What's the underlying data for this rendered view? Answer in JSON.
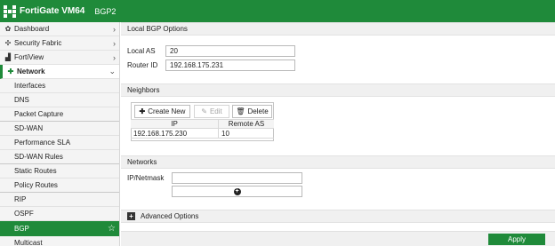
{
  "header": {
    "host": "FortiGate VM64",
    "page": "BGP2",
    "brand_color": "#1f8a3a"
  },
  "sidebar": {
    "items": [
      {
        "label": "Dashboard",
        "icon": "dashboard-icon",
        "chevron": "›"
      },
      {
        "label": "Security Fabric",
        "icon": "fabric-icon",
        "chevron": "›"
      },
      {
        "label": "FortiView",
        "icon": "chart-icon",
        "chevron": "›"
      },
      {
        "label": "Network",
        "icon": "network-icon",
        "chevron": "⌄"
      },
      {
        "label": "Interfaces"
      },
      {
        "label": "DNS"
      },
      {
        "label": "Packet Capture"
      },
      {
        "label": "SD-WAN"
      },
      {
        "label": "Performance SLA"
      },
      {
        "label": "SD-WAN Rules"
      },
      {
        "label": "Static Routes"
      },
      {
        "label": "Policy Routes"
      },
      {
        "label": "RIP"
      },
      {
        "label": "OSPF"
      },
      {
        "label": "BGP",
        "star": "☆"
      },
      {
        "label": "Multicast"
      }
    ]
  },
  "local_bgp": {
    "title": "Local BGP Options",
    "local_as_label": "Local AS",
    "local_as_value": "20",
    "router_id_label": "Router ID",
    "router_id_value": "192.168.175.231"
  },
  "neighbors": {
    "title": "Neighbors",
    "create_label": "Create New",
    "edit_label": "Edit",
    "delete_label": "Delete",
    "columns": [
      "IP",
      "Remote AS"
    ],
    "rows": [
      [
        "192.168.175.230",
        "10"
      ]
    ]
  },
  "networks": {
    "title": "Networks",
    "ip_label": "IP/Netmask",
    "ip_value": ""
  },
  "advanced": {
    "label": "Advanced Options",
    "toggle": "+"
  },
  "footer": {
    "apply_label": "Apply"
  }
}
